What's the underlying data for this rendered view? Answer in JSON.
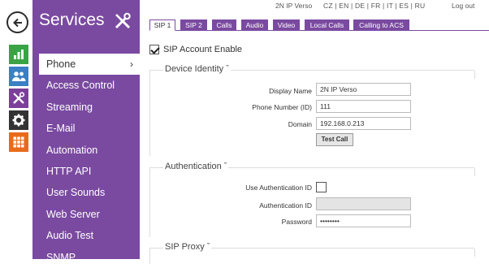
{
  "header": {
    "device_name": "2N IP Verso",
    "languages": "CZ | EN | DE | FR | IT | ES | RU",
    "logout": "Log out"
  },
  "sidebar": {
    "title": "Services",
    "items": [
      {
        "label": "Phone"
      },
      {
        "label": "Access Control"
      },
      {
        "label": "Streaming"
      },
      {
        "label": "E-Mail"
      },
      {
        "label": "Automation"
      },
      {
        "label": "HTTP API"
      },
      {
        "label": "User Sounds"
      },
      {
        "label": "Web Server"
      },
      {
        "label": "Audio Test"
      },
      {
        "label": "SNMP"
      }
    ],
    "active_chevron": "›"
  },
  "tabs": [
    {
      "label": "SIP 1"
    },
    {
      "label": "SIP 2"
    },
    {
      "label": "Calls"
    },
    {
      "label": "Audio"
    },
    {
      "label": "Video"
    },
    {
      "label": "Local Calls"
    },
    {
      "label": "Calling to ACS"
    }
  ],
  "content": {
    "sip_account_enable": {
      "label": "SIP Account Enable",
      "checked": true
    },
    "device_identity": {
      "title": "Device Identity ˇ",
      "display_name_label": "Display Name",
      "display_name_value": "2N IP Verso",
      "phone_number_label": "Phone Number (ID)",
      "phone_number_value": "111",
      "domain_label": "Domain",
      "domain_value": "192.168.0.213",
      "test_call": "Test Call"
    },
    "authentication": {
      "title": "Authentication ˇ",
      "use_auth_id_label": "Use Authentication ID",
      "use_auth_id_checked": false,
      "auth_id_label": "Authentication ID",
      "auth_id_value": "",
      "password_label": "Password",
      "password_value": "••••••••"
    },
    "sip_proxy": {
      "title": "SIP Proxy ˇ"
    }
  },
  "colors": {
    "accent": "#7a4aa0",
    "status_green": "#3aa345",
    "directory_blue": "#3b7fc4",
    "hardware_orange": "#e86b1c"
  },
  "icons": [
    "back-arrow-icon",
    "status-chart-icon",
    "directory-users-icon",
    "hardware-tools-icon",
    "system-gear-icon",
    "firmware-grid-icon",
    "services-tools-icon"
  ]
}
